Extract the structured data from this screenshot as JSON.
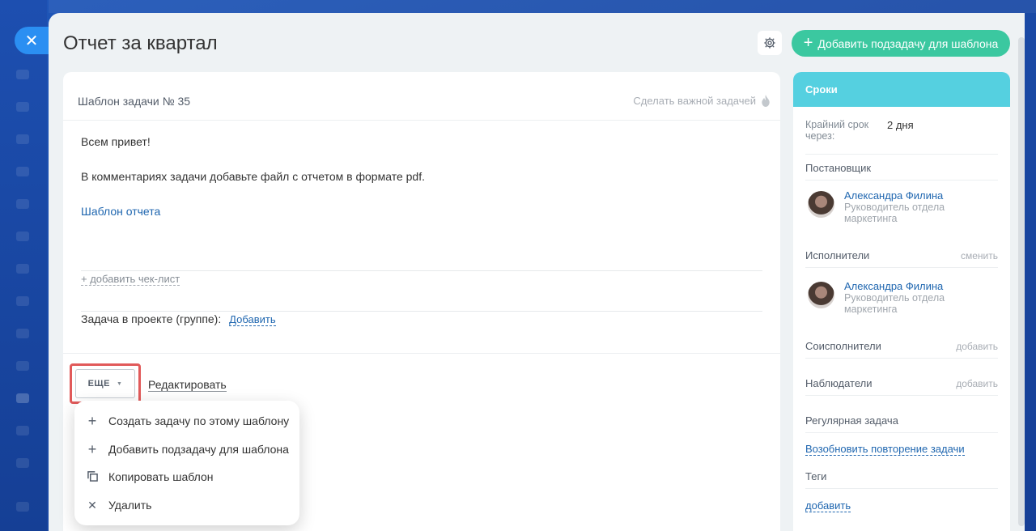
{
  "header": {
    "title": "Отчет за квартал",
    "add_subtask_label": "Добавить подзадачу для шаблона",
    "close_icon": "close-icon",
    "gear_icon": "gear-icon"
  },
  "task": {
    "template_number": "Шаблон задачи № 35",
    "make_important": "Сделать важной задачей",
    "body_line1": "Всем привет!",
    "body_line2": "В комментариях задачи добавьте файл с отчетом в формате pdf.",
    "template_link": "Шаблон отчета",
    "add_checklist": "+ добавить чек-лист",
    "project_label": "Задача в проекте (группе):",
    "project_add": "Добавить",
    "more_button": "ЕЩЕ",
    "edit_link": "Редактировать"
  },
  "menu": {
    "items": [
      {
        "label": "Создать задачу по этому шаблону",
        "icon": "plus-icon"
      },
      {
        "label": "Добавить подзадачу для шаблона",
        "icon": "plus-icon"
      },
      {
        "label": "Копировать шаблон",
        "icon": "copy-icon"
      },
      {
        "label": "Удалить",
        "icon": "close-icon"
      }
    ]
  },
  "sidebar": {
    "header": "Сроки",
    "deadline_label": "Крайний срок через:",
    "deadline_value": "2 дня",
    "creator_label": "Постановщик",
    "creator_name": "Александра Филина",
    "creator_role": "Руководитель отдела маркетинга",
    "assignees_label": "Исполнители",
    "assignees_change": "сменить",
    "assignee_name": "Александра Филина",
    "assignee_role": "Руководитель отдела маркетинга",
    "coassignees_label": "Соисполнители",
    "coassignees_add": "добавить",
    "observers_label": "Наблюдатели",
    "observers_add": "добавить",
    "recurring_label": "Регулярная задача",
    "recurring_link": "Возобновить повторение задачи",
    "tags_label": "Теги",
    "tags_add": "добавить"
  },
  "colors": {
    "accent_green": "#3bc8a0",
    "side_header": "#55d0e0",
    "link_blue": "#2067b0",
    "highlight_red": "#e15a5a"
  }
}
